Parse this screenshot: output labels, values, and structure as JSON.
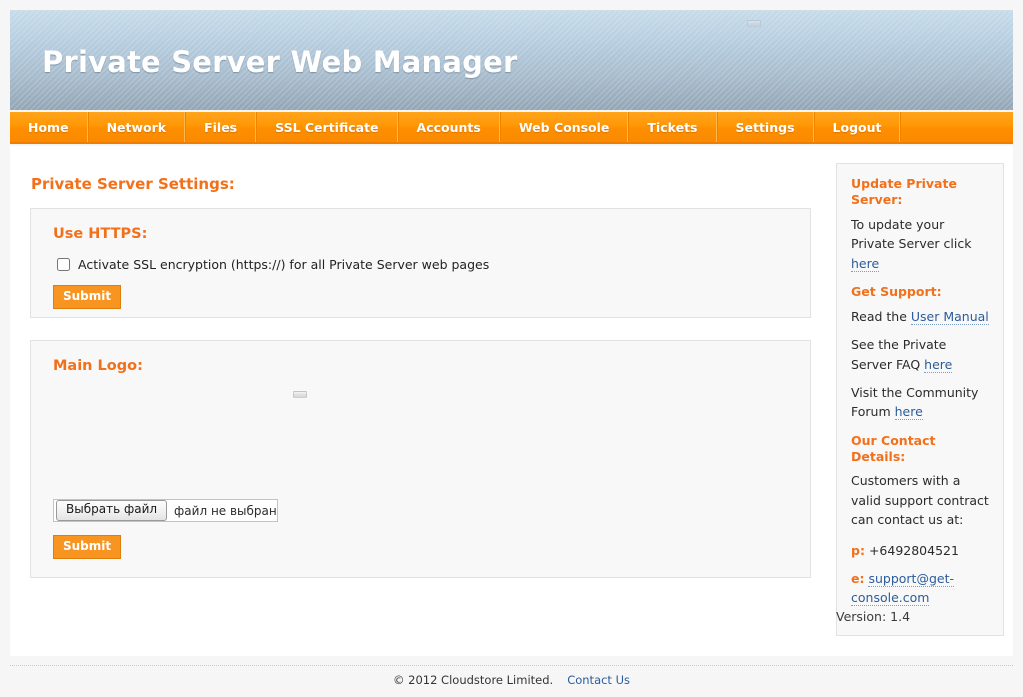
{
  "header": {
    "title": "Private Server Web Manager",
    "broken_image_icon": "broken-image-icon"
  },
  "nav": {
    "items": [
      {
        "label": "Home"
      },
      {
        "label": "Network"
      },
      {
        "label": "Files"
      },
      {
        "label": "SSL Certificate"
      },
      {
        "label": "Accounts"
      },
      {
        "label": "Web Console"
      },
      {
        "label": "Tickets"
      },
      {
        "label": "Settings"
      },
      {
        "label": "Logout"
      }
    ]
  },
  "main": {
    "page_title": "Private Server Settings:",
    "https_panel": {
      "title": "Use HTTPS:",
      "checkbox_label": "Activate SSL encryption (https://) for all Private Server web pages",
      "checkbox_checked": false,
      "submit_label": "Submit"
    },
    "logo_panel": {
      "title": "Main Logo:",
      "preview_icon": "broken-image-icon",
      "file_button_label": "Выбрать файл",
      "file_status": "файл не выбран",
      "submit_label": "Submit"
    }
  },
  "sidebar": {
    "update_heading": "Update Private Server:",
    "update_text_before": "To update your Private Server click ",
    "update_link": "here",
    "support_heading": "Get Support:",
    "manual_text_before": "Read the ",
    "manual_link": "User Manual",
    "faq_text_before": "See the Private Server FAQ ",
    "faq_link": "here",
    "forum_text_before": "Visit the Community Forum ",
    "forum_link": "here",
    "contact_heading": "Our Contact Details:",
    "contact_text": "Customers with a valid support contract can contact us at:",
    "phone_label": "p:",
    "phone_value": "+6492804521",
    "email_label": "e:",
    "email_value": "support@get-console.com"
  },
  "version_text": "Version: 1.4",
  "footer": {
    "copyright": "© 2012 Cloudstore Limited.",
    "contact_link": "Contact Us"
  },
  "colors": {
    "accent_orange": "#f3701a",
    "nav_orange": "#ff9908",
    "button_orange": "#f89420",
    "link_blue": "#2b5c9b",
    "header_blue_top": "#c6dbe9",
    "header_blue_bottom": "#94a6b5",
    "panel_bg": "#f8f8f8",
    "panel_border": "#e2e2e2"
  }
}
